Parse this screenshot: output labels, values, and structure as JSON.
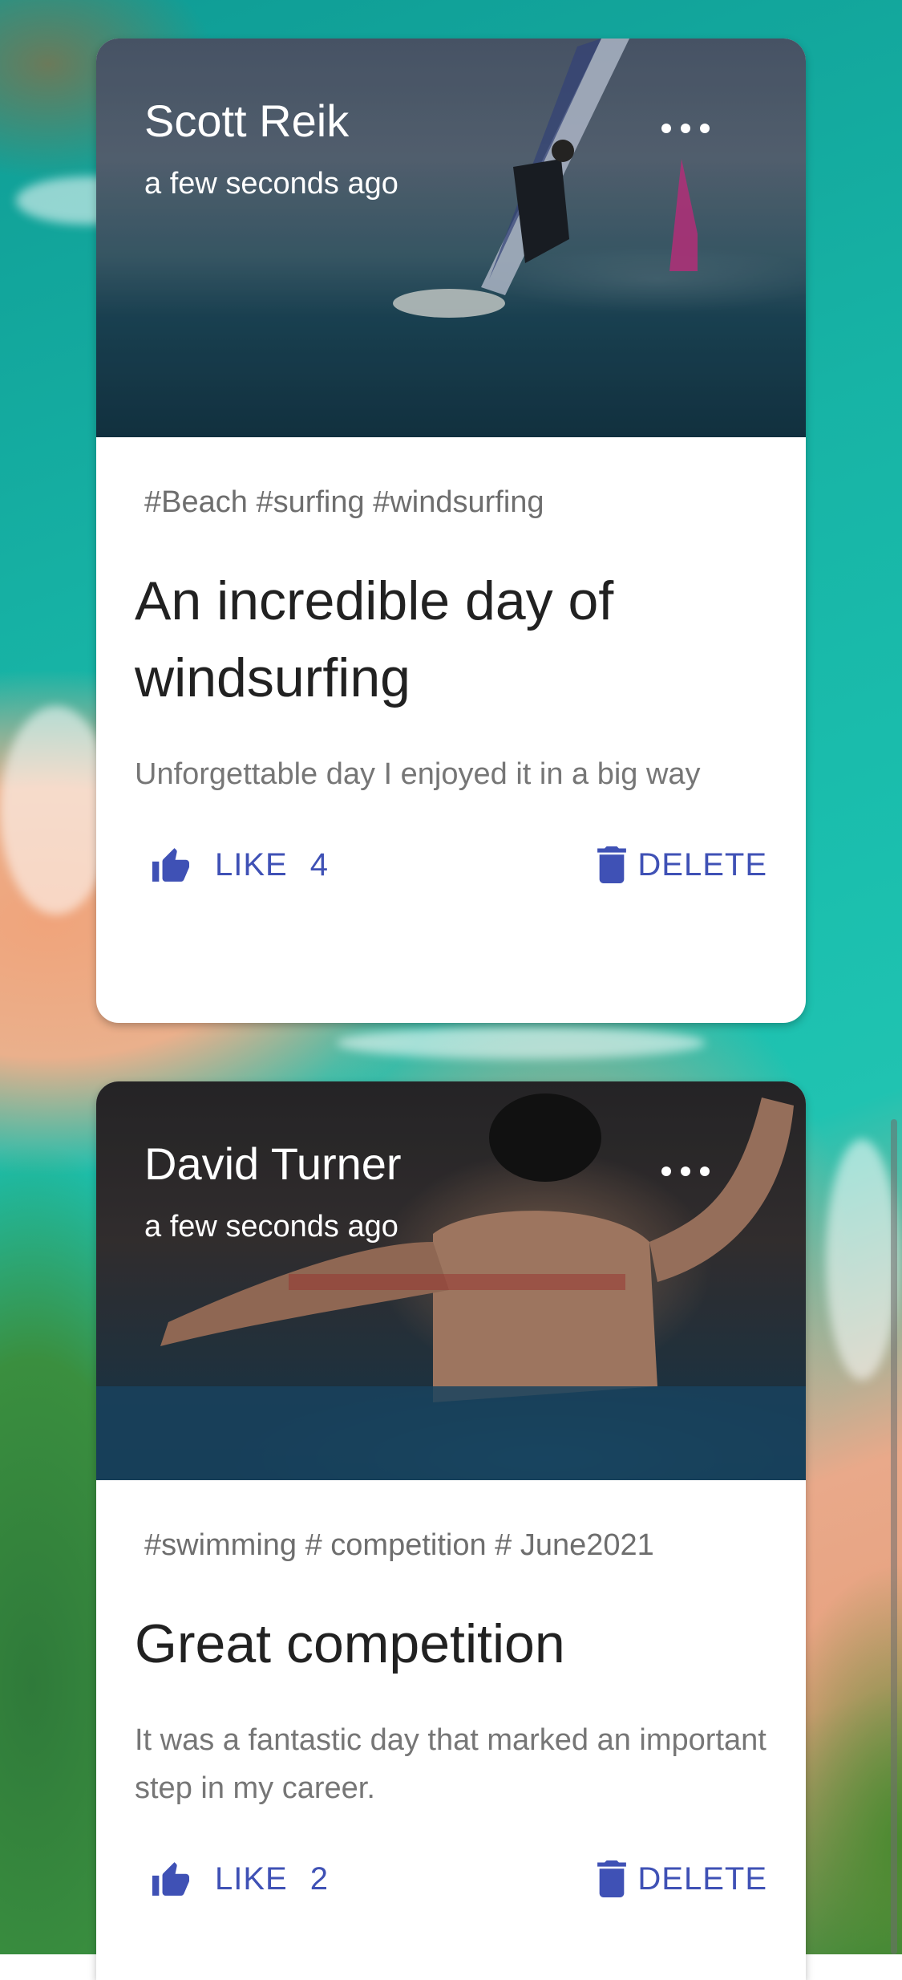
{
  "posts": [
    {
      "author": "Scott Reik",
      "time": "a few seconds ago",
      "tags": "#Beach #surfing #windsurfing",
      "title": "An incredible day of windsurfing",
      "description": "Unforgettable day I enjoyed it in a big way",
      "like_label": "LIKE",
      "likes": "4",
      "delete_label": "DELETE",
      "more_icon": "more-horiz-icon",
      "like_icon": "thumb-up-icon",
      "delete_icon": "trash-icon"
    },
    {
      "author": "David Turner",
      "time": "a few seconds ago",
      "tags": "#swimming # competition # June2021",
      "title": "Great competition",
      "description": "It was a fantastic day that marked an important step in my career.",
      "like_label": "LIKE",
      "likes": "2",
      "delete_label": "DELETE",
      "more_icon": "more-horiz-icon",
      "like_icon": "thumb-up-icon",
      "delete_icon": "trash-icon"
    }
  ],
  "colors": {
    "accent": "#3f51b5",
    "title_text": "#212121",
    "secondary_text": "#757575",
    "card": "#ffffff"
  }
}
